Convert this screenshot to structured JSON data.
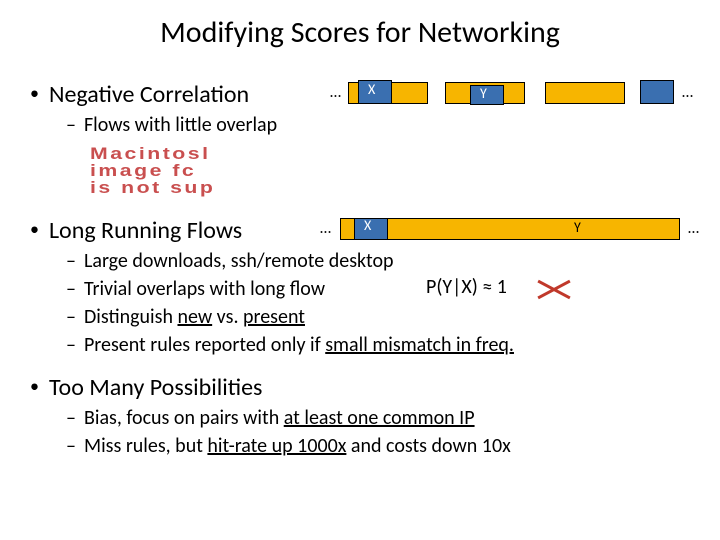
{
  "title": "Modifying Scores for Networking",
  "b1": {
    "label": "Negative Correlation",
    "sub1": "Flows with little overlap",
    "diagram": {
      "ell": "…",
      "X": "X",
      "Y": "Y"
    }
  },
  "placeholder": {
    "l1": "Macintosl",
    "l2": "image fc",
    "l3": "is not sup"
  },
  "b2": {
    "label": "Long Running Flows",
    "diagram": {
      "ell": "…",
      "X": "X",
      "Y": "Y"
    },
    "sub1": "Large downloads, ssh/remote desktop",
    "sub2a": "Trivial overlaps with long flow",
    "sub2b": "P(Y|X) ≈ 1",
    "sub3a": "Distinguish ",
    "sub3b": "new",
    "sub3c": " vs. ",
    "sub3d": "present",
    "sub4a": "Present rules reported only if ",
    "sub4b": "small mismatch in freq."
  },
  "b3": {
    "label": "Too Many Possibilities",
    "sub1a": "Bias, focus on pairs with ",
    "sub1b": "at least one common IP",
    "sub2a": "Miss rules, but ",
    "sub2b": "hit-rate up 1000x",
    "sub2c": " and costs down 10x"
  }
}
